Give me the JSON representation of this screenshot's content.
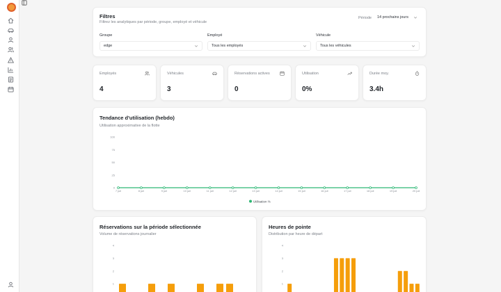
{
  "filters": {
    "title": "Filtres",
    "subtitle": "Filtrez les analytiques par période, groupe, employé et véhicule",
    "period_label": "Période",
    "period_value": "14 prochains jours",
    "group_label": "Groupe",
    "group_value": "edge",
    "employee_label": "Employé",
    "employee_value": "Tous les employés",
    "vehicle_label": "Véhicule",
    "vehicle_value": "Tous les véhicules"
  },
  "stats": [
    {
      "label": "Employés",
      "value": "4",
      "icon": "users-icon"
    },
    {
      "label": "Véhicules",
      "value": "3",
      "icon": "car-icon"
    },
    {
      "label": "Réservations actives",
      "value": "0",
      "icon": "calendar-icon"
    },
    {
      "label": "Utilisation",
      "value": "0%",
      "icon": "trending-up-icon"
    },
    {
      "label": "Durée moy.",
      "value": "3.4h",
      "icon": "timer-icon"
    }
  ],
  "colors": {
    "line": "#2bb673",
    "bar": "#f59e0b",
    "accent": "#e0602b"
  },
  "trend": {
    "title": "Tendance d'utilisation (hebdo)",
    "subtitle": "Utilisation approximative de la flotte"
  },
  "reservations": {
    "title": "Réservations sur la période sélectionnée",
    "subtitle": "Volume de réservations journalier"
  },
  "peak": {
    "title": "Heures de pointe",
    "subtitle": "Distribution par heure de départ"
  },
  "chart_data": [
    {
      "type": "line",
      "x": [
        "7 juil",
        "8 juil",
        "9 juil",
        "10 juil",
        "11 juil",
        "12 juil",
        "13 juil",
        "14 juil",
        "15 juil",
        "16 juil",
        "17 juil",
        "18 juil",
        "19 juil",
        "20 juil"
      ],
      "series": [
        {
          "name": "Utilisation %",
          "values": [
            0,
            0,
            0,
            0,
            0,
            0,
            0,
            0,
            0,
            0,
            0,
            0,
            0,
            0
          ]
        }
      ],
      "y_ticks": [
        "0",
        "25",
        "50",
        "75",
        "100"
      ],
      "ylim": [
        0,
        100
      ],
      "grid": false,
      "legend": "bottom"
    },
    {
      "type": "bar",
      "y_ticks": [
        "1",
        "2",
        "3",
        "4"
      ],
      "ylim": [
        0,
        4
      ],
      "values": [
        1,
        0,
        0,
        1,
        0,
        1,
        0,
        0,
        1,
        0,
        1,
        1
      ]
    },
    {
      "type": "bar",
      "y_ticks": [
        "1",
        "2",
        "3",
        "4"
      ],
      "ylim": [
        0,
        4
      ],
      "values": [
        1,
        0,
        0,
        0,
        0,
        0,
        0,
        0,
        3,
        3,
        3,
        3,
        0,
        0,
        0,
        0,
        0,
        0,
        0,
        2,
        2,
        1,
        1
      ]
    }
  ]
}
